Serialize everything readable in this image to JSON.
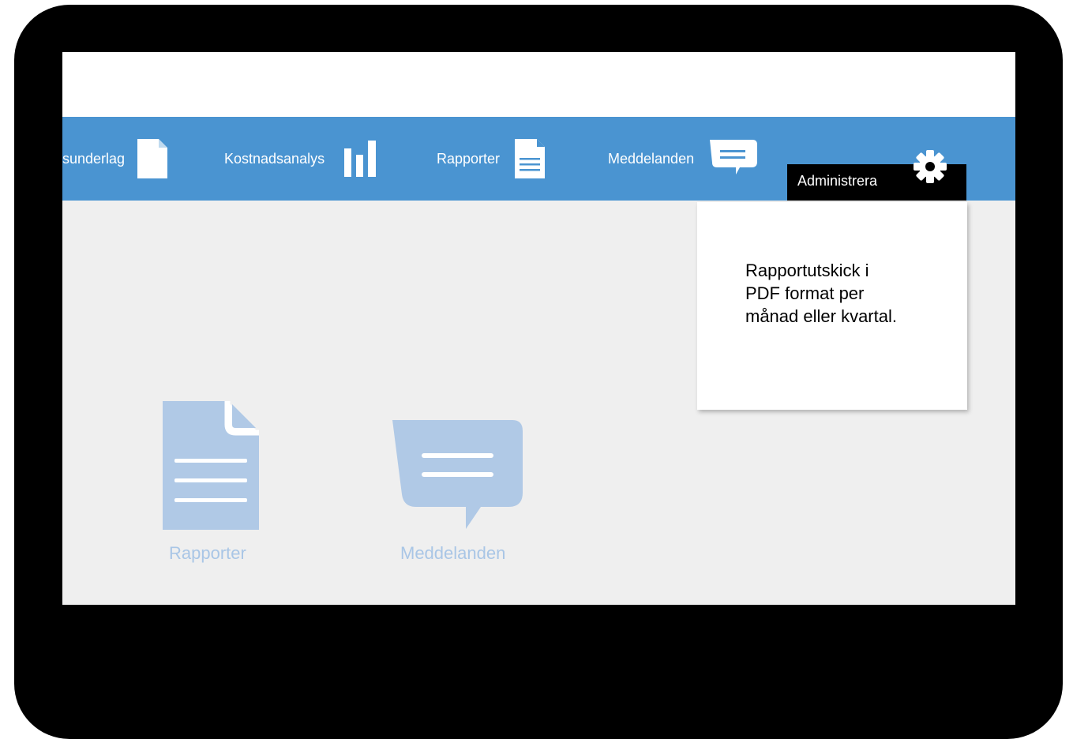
{
  "nav": {
    "items": [
      {
        "label": "sunderlag",
        "icon": "document-icon"
      },
      {
        "label": "Kostnadsanalys",
        "icon": "bar-chart-icon"
      },
      {
        "label": "Rapporter",
        "icon": "report-icon"
      },
      {
        "label": "Meddelanden",
        "icon": "message-icon"
      }
    ],
    "admin": {
      "label": "Administrera",
      "icon": "gear-icon"
    }
  },
  "dropdown": {
    "line1": "Rapportutskick i",
    "line2": "PDF format per",
    "line3": "månad eller kvartal."
  },
  "tiles": [
    {
      "label": "Rapporter",
      "icon": "report-icon"
    },
    {
      "label": "Meddelanden",
      "icon": "message-icon"
    }
  ],
  "colors": {
    "nav_bg": "#4a94d1",
    "tile_icon": "#b0c9e6",
    "device_frame": "#000000",
    "admin_bg": "#000000"
  }
}
